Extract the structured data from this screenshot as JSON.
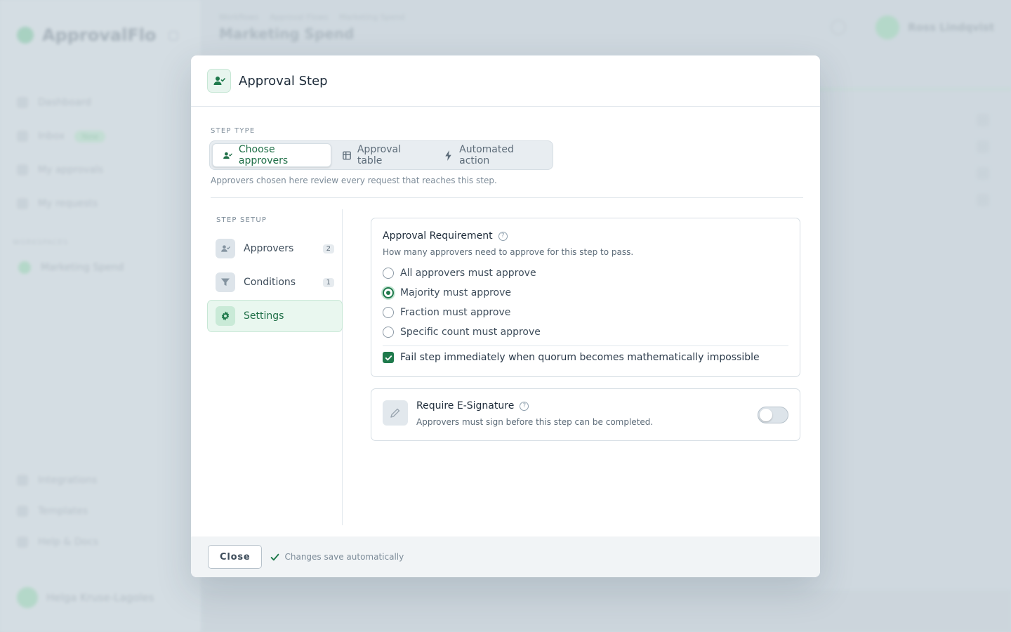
{
  "background": {
    "brand": "ApprovalFlo",
    "nav_items": [
      "Dashboard",
      "Inbox",
      "My approvals",
      "My requests"
    ],
    "inbox_badge": "New",
    "section_label": "WORKSPACES",
    "workspace": "Marketing Spend",
    "bottom_items": [
      "Integrations",
      "Templates",
      "Help & Docs"
    ],
    "user_short": "Helga Kruse-Lagoles",
    "breadcrumbs": [
      "Workflows",
      "Approval Flows",
      "Marketing Spend"
    ],
    "page_title": "Marketing Spend",
    "top_user_name": "Ross Lindqvist"
  },
  "modal": {
    "title": "Approval Step",
    "step_type_label": "STEP TYPE",
    "step_types": [
      {
        "label": "Choose approvers",
        "icon": "user-check-icon",
        "active": true
      },
      {
        "label": "Approval table",
        "icon": "table-icon",
        "active": false
      },
      {
        "label": "Automated action",
        "icon": "lightning-icon",
        "active": false
      }
    ],
    "step_type_hint": "Approvers chosen here review every request that reaches this step.",
    "setup_label": "STEP SETUP",
    "setup_items": [
      {
        "label": "Approvers",
        "count": "2",
        "icon": "user-check-icon"
      },
      {
        "label": "Conditions",
        "count": "1",
        "icon": "filter-icon"
      },
      {
        "label": "Settings",
        "count": "",
        "icon": "gear-icon",
        "active": true
      }
    ],
    "requirement": {
      "title": "Approval Requirement",
      "subtitle": "How many approvers need to approve for this step to pass.",
      "options": [
        "All approvers must approve",
        "Majority must approve",
        "Fraction must approve",
        "Specific count must approve"
      ],
      "selected": "Majority must approve",
      "fail_fast_label": "Fail step immediately when quorum becomes mathematically impossible",
      "fail_fast_checked": true
    },
    "signature": {
      "title": "Require E-Signature",
      "subtitle": "Approvers must sign before this step can be completed.",
      "enabled": false
    },
    "footer": {
      "close_label": "Close",
      "autosave_text": "Changes save automatically"
    }
  },
  "colors": {
    "accent": "#1f7a4c",
    "accent_light": "#e9f7ef",
    "overlay": "#c8d2da"
  }
}
